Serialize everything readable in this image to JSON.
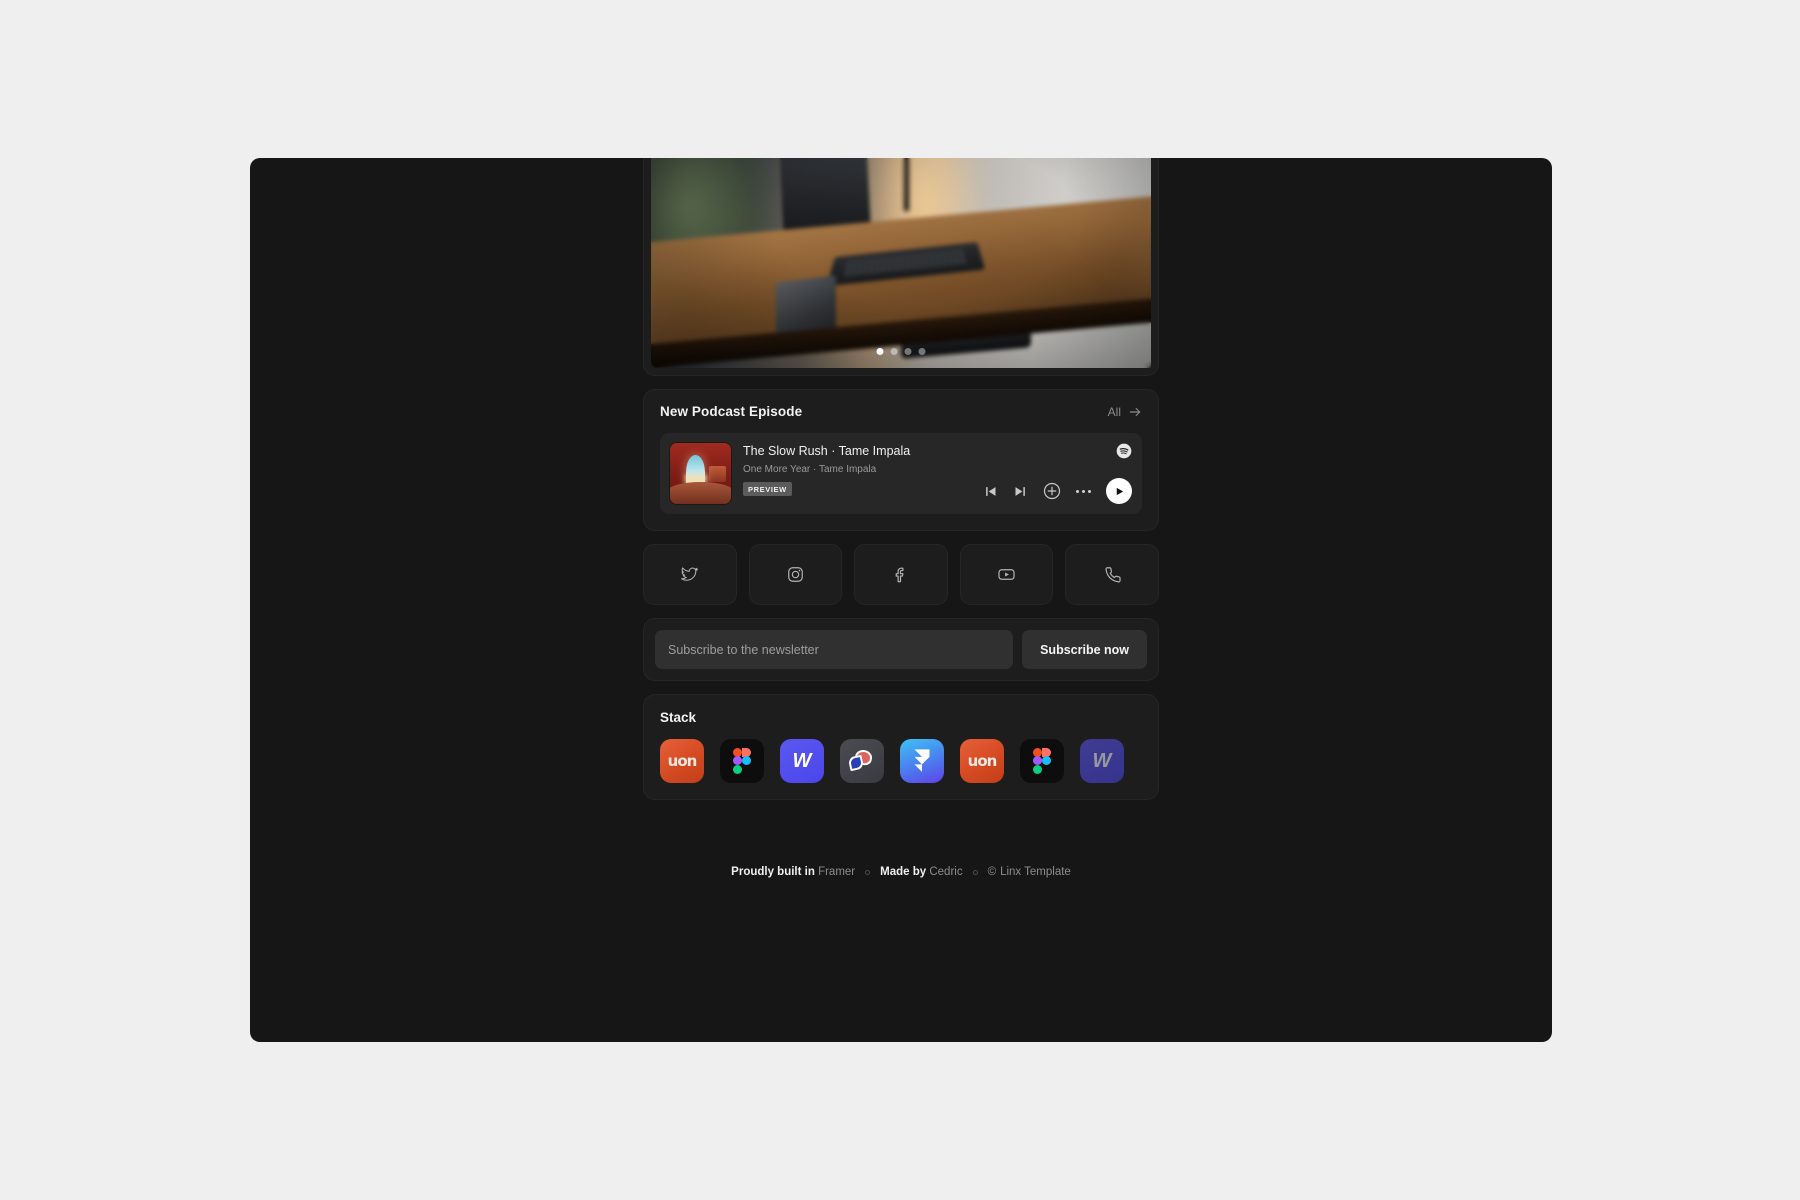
{
  "page": {
    "background_color": "#f0efef",
    "canvas_color": "#161616"
  },
  "carousel": {
    "name": "photo-carousel",
    "dots_total": 4,
    "active_dot": 1,
    "image_alt": "Laptop on a wooden desk at dusk with a plant and a phone"
  },
  "podcast": {
    "section_title": "New Podcast Episode",
    "all_label": "All",
    "all_icon": "arrow-right-icon",
    "provider_icon": "spotify-icon",
    "track": {
      "title": "The Slow Rush · Tame Impala",
      "subtitle": "One More Year · Tame Impala",
      "badge": "PREVIEW",
      "artwork_alt": "The Slow Rush album cover"
    },
    "controls": [
      {
        "name": "previous-track-button",
        "icon": "skip-back-icon"
      },
      {
        "name": "next-track-button",
        "icon": "skip-forward-icon"
      },
      {
        "name": "add-to-library-button",
        "icon": "plus-circle-icon"
      },
      {
        "name": "more-options-button",
        "icon": "ellipsis-icon"
      },
      {
        "name": "play-button",
        "icon": "play-icon"
      }
    ]
  },
  "social": {
    "items": [
      {
        "name": "twitter",
        "icon": "twitter-icon"
      },
      {
        "name": "instagram",
        "icon": "instagram-icon"
      },
      {
        "name": "facebook",
        "icon": "facebook-icon"
      },
      {
        "name": "youtube",
        "icon": "youtube-icon"
      },
      {
        "name": "phone",
        "icon": "phone-icon"
      }
    ]
  },
  "newsletter": {
    "placeholder": "Subscribe to the newsletter",
    "value": "",
    "button_label": "Subscribe now"
  },
  "stack": {
    "title": "Stack",
    "items": [
      {
        "name": "notion",
        "label": "uon",
        "style": "ic-notion"
      },
      {
        "name": "figma",
        "label": "",
        "style": "ic-figma"
      },
      {
        "name": "webflow",
        "label": "W",
        "style": "ic-webflow"
      },
      {
        "name": "spline",
        "label": "",
        "style": "ic-spline"
      },
      {
        "name": "framer",
        "label": "",
        "style": "ic-framer"
      },
      {
        "name": "notion-2",
        "label": "uon",
        "style": "ic-notion"
      },
      {
        "name": "figma-2",
        "label": "",
        "style": "ic-figma"
      },
      {
        "name": "webflow-2",
        "label": "W",
        "style": "ic-webflow"
      }
    ]
  },
  "footer": {
    "built_prefix": "Proudly built in",
    "built_name": "Framer",
    "made_prefix": "Made by",
    "made_name": "Cedric",
    "copyright_symbol": "©",
    "copyright_text": "Linx Template"
  }
}
